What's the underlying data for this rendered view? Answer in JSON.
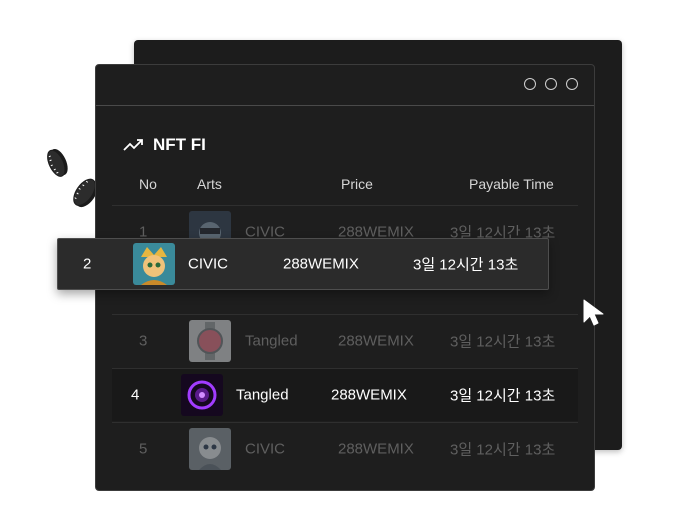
{
  "window": {
    "title": "NFT FI",
    "trend_icon": "trending-up-icon"
  },
  "table": {
    "headers": {
      "no": "No",
      "arts": "Arts",
      "price": "Price",
      "payable": "Payable Time"
    },
    "rows": [
      {
        "no": "1",
        "art": "CIVIC",
        "price": "288WEMIX",
        "time": "3일 12시간 13초",
        "thumb": "civic-avatar",
        "state": "faded"
      },
      {
        "no": "3",
        "art": "Tangled",
        "price": "288WEMIX",
        "time": "3일 12시간 13초",
        "thumb": "watch",
        "state": "faded"
      },
      {
        "no": "4",
        "art": "Tangled",
        "price": "288WEMIX",
        "time": "3일 12시간 13초",
        "thumb": "purple-orb",
        "state": "active"
      },
      {
        "no": "5",
        "art": "CIVIC",
        "price": "288WEMIX",
        "time": "3일 12시간 13초",
        "thumb": "civic-avatar",
        "state": "faded"
      }
    ],
    "highlighted": {
      "no": "2",
      "art": "CIVIC",
      "price": "288WEMIX",
      "time": "3일 12시간 13초",
      "thumb": "golden-character"
    }
  },
  "colors": {
    "background": "#ffffff",
    "window": "#1e1e1e",
    "popup": "#2b2b2b",
    "faded_text": "#5f5f5f"
  }
}
